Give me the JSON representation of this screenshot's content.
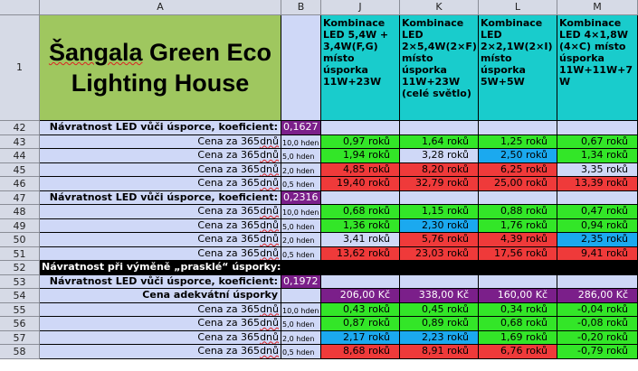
{
  "columns": [
    "A",
    "B",
    "J",
    "K",
    "L",
    "M"
  ],
  "title": {
    "line1_word1": "Šangala",
    "line1_word2": "Green Eco",
    "line2": "Lighting House",
    "row_number": "1"
  },
  "headers": {
    "J": "Kombinace LED 5,4W + 3,4W(F,G) místo úsporka 11W+23W",
    "K": "Kombinace LED 2×5,4W(2×F) místo úsporka 11W+23W (celé světlo)",
    "L": "Kombinace LED 2×2,1W(2×I) místo úsporka 5W+5W",
    "M": "Kombinace LED 4×1,8W (4×C) místo úsporka 11W+11W+7 W"
  },
  "rows": [
    {
      "num": "42",
      "kind": "coef",
      "label": "Návratnost LED vůči úsporce, koeficient:",
      "coef": "0,1627"
    },
    {
      "num": "43",
      "kind": "data",
      "label": "Cena za 365dnů",
      "unit": "10,0 hden",
      "cells": [
        [
          "0,97 roků",
          "g"
        ],
        [
          "1,64 roků",
          "g"
        ],
        [
          "1,25 roků",
          "g"
        ],
        [
          "0,67 roků",
          "g"
        ]
      ]
    },
    {
      "num": "44",
      "kind": "data",
      "label": "Cena za 365dnů",
      "unit": "5,0 hden",
      "cells": [
        [
          "1,94 roků",
          "g"
        ],
        [
          "3,28 roků",
          "l"
        ],
        [
          "2,50 roků",
          "b"
        ],
        [
          "1,34 roků",
          "g"
        ]
      ]
    },
    {
      "num": "45",
      "kind": "data",
      "label": "Cena za 365dnů",
      "unit": "2,0 hden",
      "cells": [
        [
          "4,85 roků",
          "r"
        ],
        [
          "8,20 roků",
          "r"
        ],
        [
          "6,25 roků",
          "r"
        ],
        [
          "3,35 roků",
          "l"
        ]
      ]
    },
    {
      "num": "46",
      "kind": "data",
      "label": "Cena za 365dnů",
      "unit": "0,5 hden",
      "cells": [
        [
          "19,40 roků",
          "r"
        ],
        [
          "32,79 roků",
          "r"
        ],
        [
          "25,00 roků",
          "r"
        ],
        [
          "13,39 roků",
          "r"
        ]
      ]
    },
    {
      "num": "47",
      "kind": "coef",
      "label": "Návratnost LED vůči úsporce, koeficient:",
      "coef": "0,2316"
    },
    {
      "num": "48",
      "kind": "data",
      "label": "Cena za 365dnů",
      "unit": "10,0 hden",
      "cells": [
        [
          "0,68 roků",
          "g"
        ],
        [
          "1,15 roků",
          "g"
        ],
        [
          "0,88 roků",
          "g"
        ],
        [
          "0,47 roků",
          "g"
        ]
      ]
    },
    {
      "num": "49",
      "kind": "data",
      "label": "Cena za 365dnů",
      "unit": "5,0 hden",
      "cells": [
        [
          "1,36 roků",
          "g"
        ],
        [
          "2,30 roků",
          "b"
        ],
        [
          "1,76 roků",
          "g"
        ],
        [
          "0,94 roků",
          "g"
        ]
      ]
    },
    {
      "num": "50",
      "kind": "data",
      "label": "Cena za 365dnů",
      "unit": "2,0 hden",
      "cells": [
        [
          "3,41 roků",
          "l"
        ],
        [
          "5,76 roků",
          "r"
        ],
        [
          "4,39 roků",
          "r"
        ],
        [
          "2,35 roků",
          "b"
        ]
      ]
    },
    {
      "num": "51",
      "kind": "data",
      "label": "Cena za 365dnů",
      "unit": "0,5 hden",
      "cells": [
        [
          "13,62 roků",
          "r"
        ],
        [
          "23,03 roků",
          "r"
        ],
        [
          "17,56 roků",
          "r"
        ],
        [
          "9,41 roků",
          "r"
        ]
      ]
    },
    {
      "num": "52",
      "kind": "black",
      "label": "Návratnost při výměně „prasklé“ úsporky:"
    },
    {
      "num": "53",
      "kind": "coef",
      "label": "Návratnost LED vůči úsporce, koeficient:",
      "coef": "0,1972"
    },
    {
      "num": "54",
      "kind": "price",
      "label": "Cena adekvátní úsporky",
      "cells": [
        [
          "206,00 Kč",
          "p"
        ],
        [
          "338,00 Kč",
          "p"
        ],
        [
          "160,00 Kč",
          "p"
        ],
        [
          "286,00 Kč",
          "p"
        ]
      ]
    },
    {
      "num": "55",
      "kind": "data",
      "label": "Cena za 365dnů",
      "unit": "10,0 hden",
      "cells": [
        [
          "0,43 roků",
          "g"
        ],
        [
          "0,45 roků",
          "g"
        ],
        [
          "0,34 roků",
          "g"
        ],
        [
          "-0,04 roků",
          "g"
        ]
      ]
    },
    {
      "num": "56",
      "kind": "data",
      "label": "Cena za 365dnů",
      "unit": "5,0 hden",
      "cells": [
        [
          "0,87 roků",
          "g"
        ],
        [
          "0,89 roků",
          "g"
        ],
        [
          "0,68 roků",
          "g"
        ],
        [
          "-0,08 roků",
          "g"
        ]
      ]
    },
    {
      "num": "57",
      "kind": "data",
      "label": "Cena za 365dnů",
      "unit": "2,0 hden",
      "cells": [
        [
          "2,17 roků",
          "b"
        ],
        [
          "2,23 roků",
          "b"
        ],
        [
          "1,69 roků",
          "g"
        ],
        [
          "-0,20 roků",
          "g"
        ]
      ]
    },
    {
      "num": "58",
      "kind": "data",
      "label": "Cena za 365dnů",
      "unit": "0,5 hden",
      "cells": [
        [
          "8,68 roků",
          "r"
        ],
        [
          "8,91 roků",
          "r"
        ],
        [
          "6,76 roků",
          "r"
        ],
        [
          "-0,79 roků",
          "g"
        ]
      ]
    }
  ]
}
